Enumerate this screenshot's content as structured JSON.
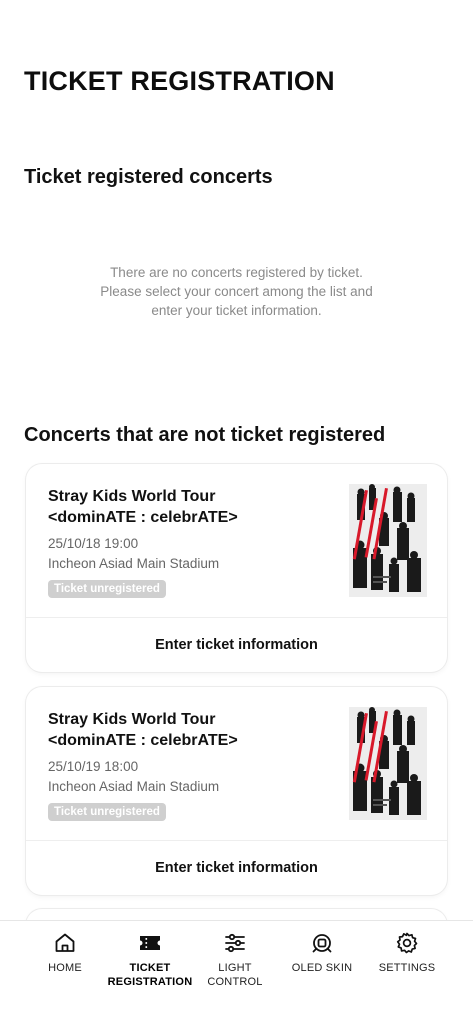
{
  "header": {
    "title": "TICKET REGISTRATION"
  },
  "registered": {
    "section_title": "Ticket registered concerts",
    "empty_lines": [
      "There are no concerts registered by ticket.",
      "Please select your concert among the list and",
      "enter your ticket information."
    ]
  },
  "unregistered": {
    "section_title": "Concerts that are not ticket registered",
    "concerts": [
      {
        "title_line1": "Stray Kids World Tour",
        "title_line2": "<dominATE : celebrATE>",
        "datetime": "25/10/18 19:00",
        "venue": "Incheon Asiad Main Stadium",
        "badge": "Ticket unregistered",
        "action": "Enter ticket information"
      },
      {
        "title_line1": "Stray Kids World Tour",
        "title_line2": "<dominATE : celebrATE>",
        "datetime": "25/10/19 18:00",
        "venue": "Incheon Asiad Main Stadium",
        "badge": "Ticket unregistered",
        "action": "Enter ticket information"
      }
    ]
  },
  "tabbar": {
    "items": [
      {
        "label_line1": "HOME",
        "label_line2": "",
        "icon": "home-icon",
        "active": false
      },
      {
        "label_line1": "TICKET",
        "label_line2": "REGISTRATION",
        "icon": "ticket-icon",
        "active": true
      },
      {
        "label_line1": "LIGHT",
        "label_line2": "CONTROL",
        "icon": "sliders-icon",
        "active": false
      },
      {
        "label_line1": "OLED SKIN",
        "label_line2": "",
        "icon": "oled-skin-icon",
        "active": false
      },
      {
        "label_line1": "SETTINGS",
        "label_line2": "",
        "icon": "gear-icon",
        "active": false
      }
    ]
  },
  "colors": {
    "badge_bg": "#cfcfcf",
    "secondary_text": "#666666",
    "empty_text": "#8a8a8a"
  }
}
